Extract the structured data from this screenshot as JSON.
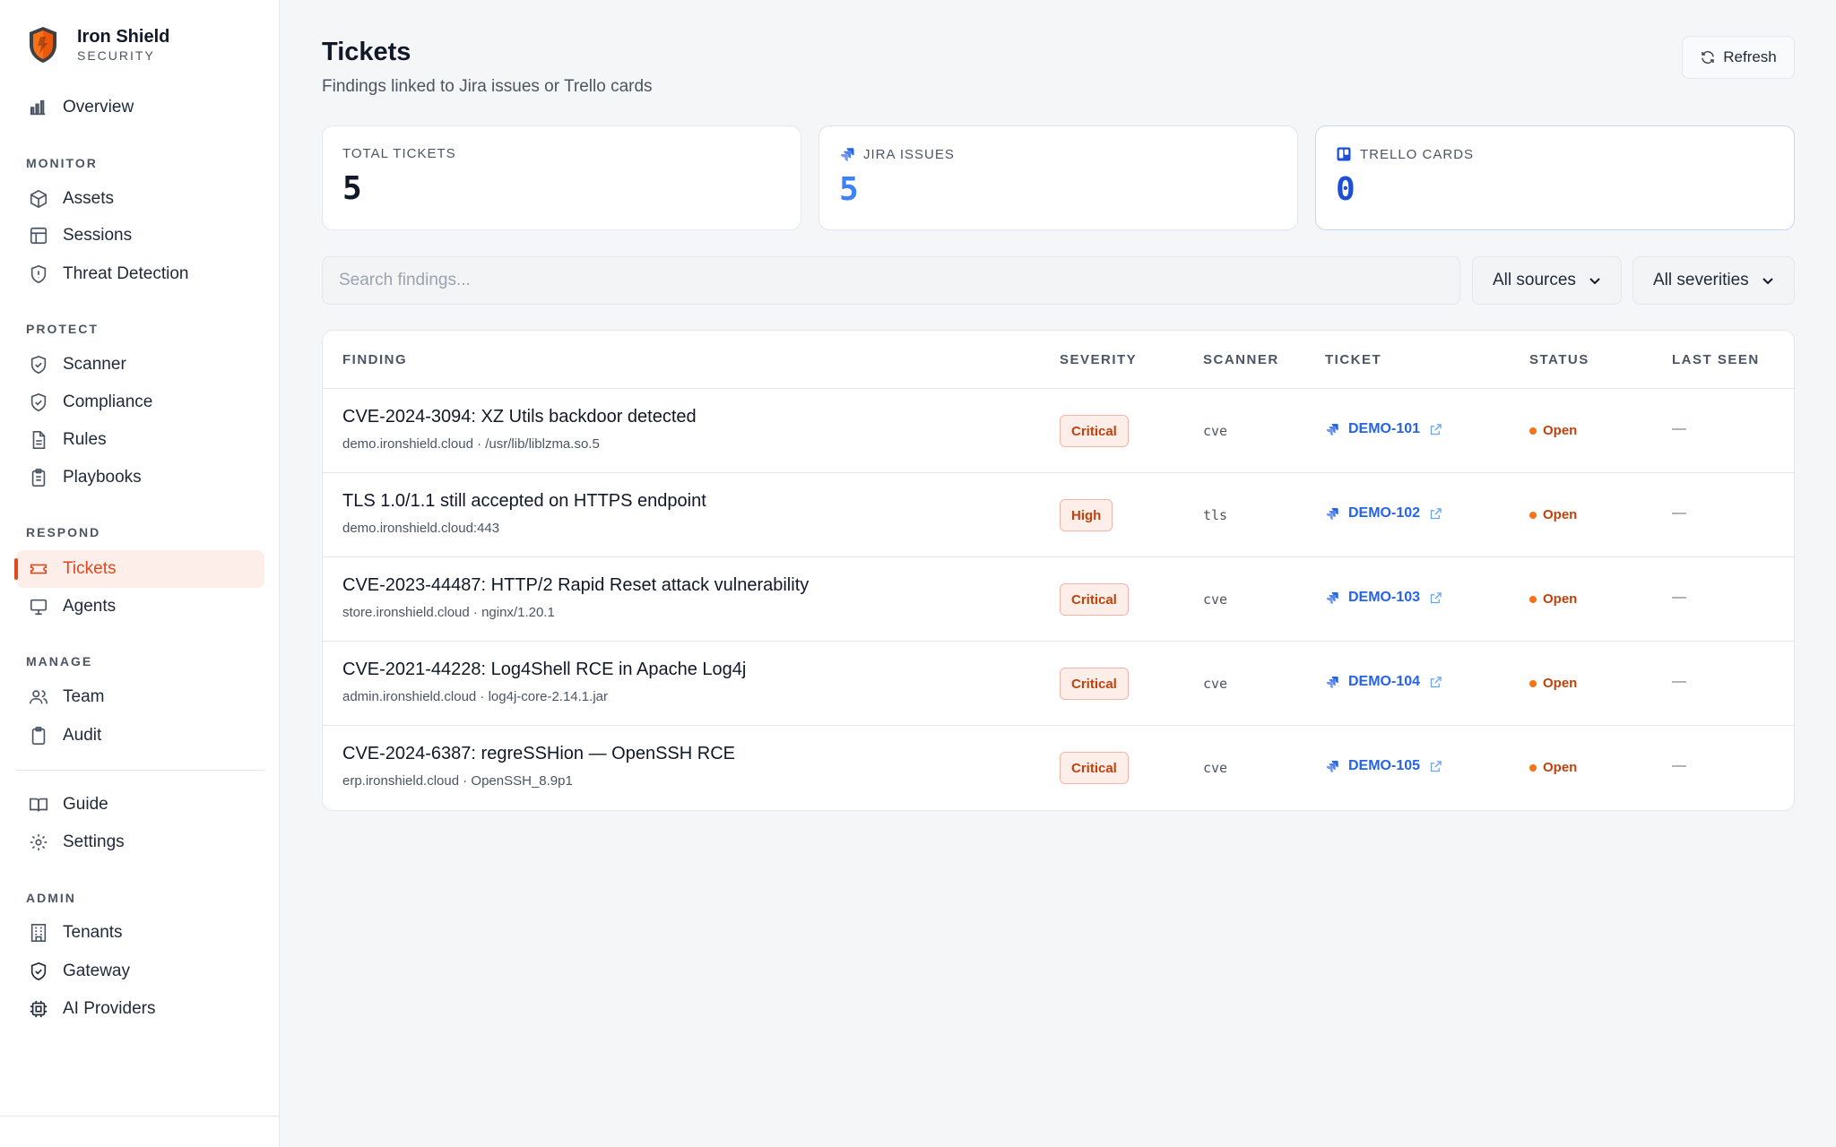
{
  "brand": {
    "name": "Iron Shield",
    "sub": "SECURITY"
  },
  "nav": {
    "overview": "Overview",
    "monitor_section": "MONITOR",
    "assets": "Assets",
    "sessions": "Sessions",
    "threat_detection": "Threat Detection",
    "protect_section": "PROTECT",
    "scanner": "Scanner",
    "compliance": "Compliance",
    "rules": "Rules",
    "playbooks": "Playbooks",
    "respond_section": "RESPOND",
    "tickets": "Tickets",
    "agents": "Agents",
    "manage_section": "MANAGE",
    "team": "Team",
    "audit": "Audit",
    "guide": "Guide",
    "settings": "Settings",
    "admin_section": "ADMIN",
    "tenants": "Tenants",
    "gateway": "Gateway",
    "ai_providers": "AI Providers"
  },
  "header": {
    "title": "Tickets",
    "subtitle": "Findings linked to Jira issues or Trello cards",
    "refresh_label": "Refresh"
  },
  "stats": {
    "total": {
      "label": "TOTAL TICKETS",
      "value": "5"
    },
    "jira": {
      "label": "JIRA ISSUES",
      "value": "5"
    },
    "trello": {
      "label": "TRELLO CARDS",
      "value": "0"
    }
  },
  "filters": {
    "search_placeholder": "Search findings...",
    "source": "All sources",
    "severity": "All severities"
  },
  "table": {
    "columns": {
      "finding": "FINDING",
      "severity": "SEVERITY",
      "scanner": "SCANNER",
      "ticket": "TICKET",
      "status": "STATUS",
      "last_seen": "LAST SEEN"
    },
    "rows": [
      {
        "title": "CVE-2024-3094: XZ Utils backdoor detected",
        "sub": "demo.ironshield.cloud · /usr/lib/liblzma.so.5",
        "severity": "Critical",
        "scanner": "cve",
        "ticket": "DEMO-101",
        "status": "Open",
        "last_seen": "—"
      },
      {
        "title": "TLS 1.0/1.1 still accepted on HTTPS endpoint",
        "sub": "demo.ironshield.cloud:443",
        "severity": "High",
        "scanner": "tls",
        "ticket": "DEMO-102",
        "status": "Open",
        "last_seen": "—"
      },
      {
        "title": "CVE-2023-44487: HTTP/2 Rapid Reset attack vulnerability",
        "sub": "store.ironshield.cloud · nginx/1.20.1",
        "severity": "Critical",
        "scanner": "cve",
        "ticket": "DEMO-103",
        "status": "Open",
        "last_seen": "—"
      },
      {
        "title": "CVE-2021-44228: Log4Shell RCE in Apache Log4j",
        "sub": "admin.ironshield.cloud · log4j-core-2.14.1.jar",
        "severity": "Critical",
        "scanner": "cve",
        "ticket": "DEMO-104",
        "status": "Open",
        "last_seen": "—"
      },
      {
        "title": "CVE-2024-6387: regreSSHion — OpenSSH RCE",
        "sub": "erp.ironshield.cloud · OpenSSH_8.9p1",
        "severity": "Critical",
        "scanner": "cve",
        "ticket": "DEMO-105",
        "status": "Open",
        "last_seen": "—"
      }
    ]
  },
  "colors": {
    "accent": "#e0481f",
    "jira_blue": "#2563eb",
    "status_open": "#f97316"
  }
}
